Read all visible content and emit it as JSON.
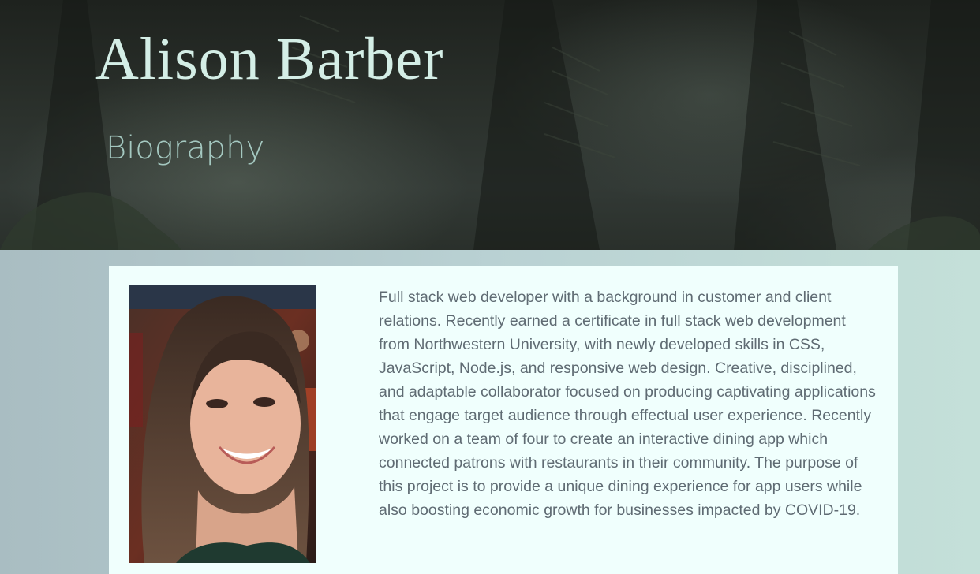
{
  "header": {
    "name": "Alison Barber",
    "section": "Biography"
  },
  "about": {
    "photo_icon": "profile-photo",
    "bio": "Full stack web developer with a background in customer and client relations. Recently earned a certificate in full stack web development from Northwestern University, with newly developed skills in CSS, JavaScript, Node.js, and responsive web design. Creative, disciplined, and adaptable collaborator focused on producing captivating applications that engage target audience through effectual user experience. Recently worked on a team of four to create an interactive dining app which connected patrons with restaurants in their community. The purpose of this project is to provide a unique dining experience for app users while also boosting economic growth for businesses impacted by COVID-19."
  },
  "colors": {
    "title": "#d4eee6",
    "subtitle": "#a4c8c0",
    "card_bg": "#f0fffd",
    "body_text": "#5f6b73"
  }
}
